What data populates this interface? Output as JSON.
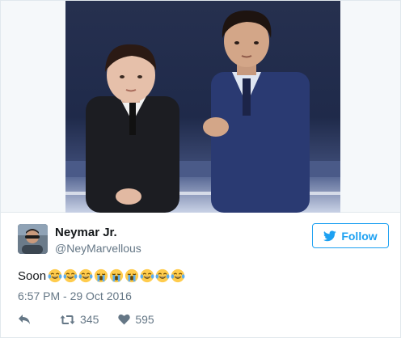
{
  "tweet": {
    "author": {
      "name": "Neymar Jr.",
      "handle": "@NeyMarvellous"
    },
    "follow_label": "Follow",
    "text": "Soon",
    "emojis": [
      "tears-of-joy",
      "tears-of-joy",
      "tears-of-joy",
      "loudly-crying",
      "loudly-crying",
      "loudly-crying",
      "tears-of-joy",
      "tears-of-joy",
      "tears-of-joy"
    ],
    "timestamp": "6:57 PM - 29 Oct 2016",
    "retweet_count": "345",
    "like_count": "595"
  },
  "colors": {
    "accent": "#1da1f2",
    "secondary_text": "#657786",
    "border": "#e1e8ed"
  }
}
